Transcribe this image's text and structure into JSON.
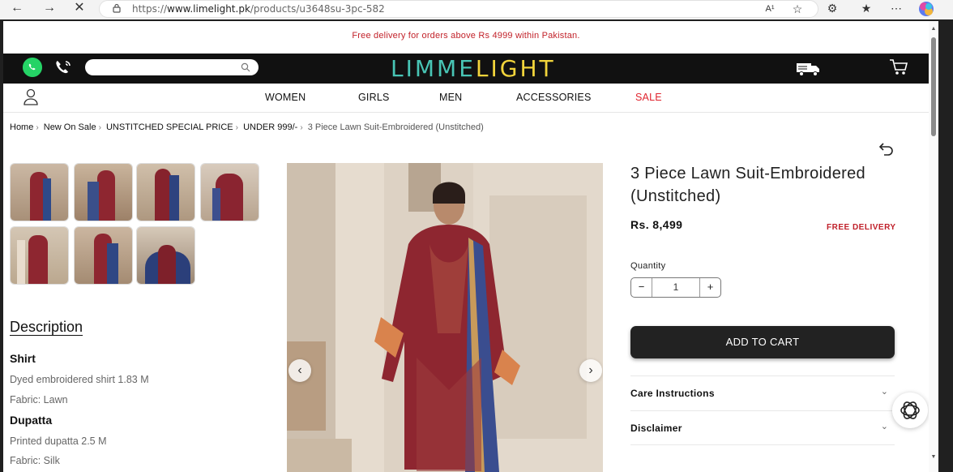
{
  "browser": {
    "url_prefix": "https://",
    "url_domain": "www.limelight.pk",
    "url_path": "/products/u3648su-3pc-582",
    "back_icon": "arrow-left",
    "forward_icon": "arrow-right",
    "stop_icon": "close",
    "read_aloud": "A¹"
  },
  "promo": {
    "text": "Free delivery for orders above Rs 4999 within Pakistan."
  },
  "header": {
    "logo_part1": "LI",
    "logo_part2": "MM",
    "logo_part3": "E",
    "logo_part4": "LIGHT",
    "colors": {
      "logo_teal": "#48c5b5",
      "logo_yellow": "#f2d43b",
      "header_bg": "#111111"
    }
  },
  "nav": {
    "items": [
      "WOMEN",
      "GIRLS",
      "MEN",
      "ACCESSORIES",
      "SALE"
    ]
  },
  "breadcrumb": {
    "items": [
      "Home",
      "New On Sale",
      "UNSTITCHED SPECIAL PRICE",
      "UNDER 999/-"
    ],
    "current": "3 Piece Lawn Suit-Embroidered (Unstitched)"
  },
  "description": {
    "title": "Description",
    "shirt_heading": "Shirt",
    "shirt_line1": "Dyed embroidered shirt 1.83 M",
    "shirt_line2": "Fabric: Lawn",
    "dupatta_heading": "Dupatta",
    "dupatta_line1": "Printed dupatta 2.5 M",
    "dupatta_line2": "Fabric: Silk"
  },
  "product": {
    "title": "3 Piece Lawn Suit-Embroidered (Unstitched)",
    "price": "Rs. 8,499",
    "free_delivery": "FREE DELIVERY",
    "quantity_label": "Quantity",
    "quantity_value": "1",
    "minus": "−",
    "plus": "+",
    "add_to_cart": "ADD TO CART",
    "accordions": [
      "Care Instructions",
      "Disclaimer"
    ],
    "colors": {
      "accent_red": "#c0202a",
      "button_bg": "#222222"
    }
  }
}
